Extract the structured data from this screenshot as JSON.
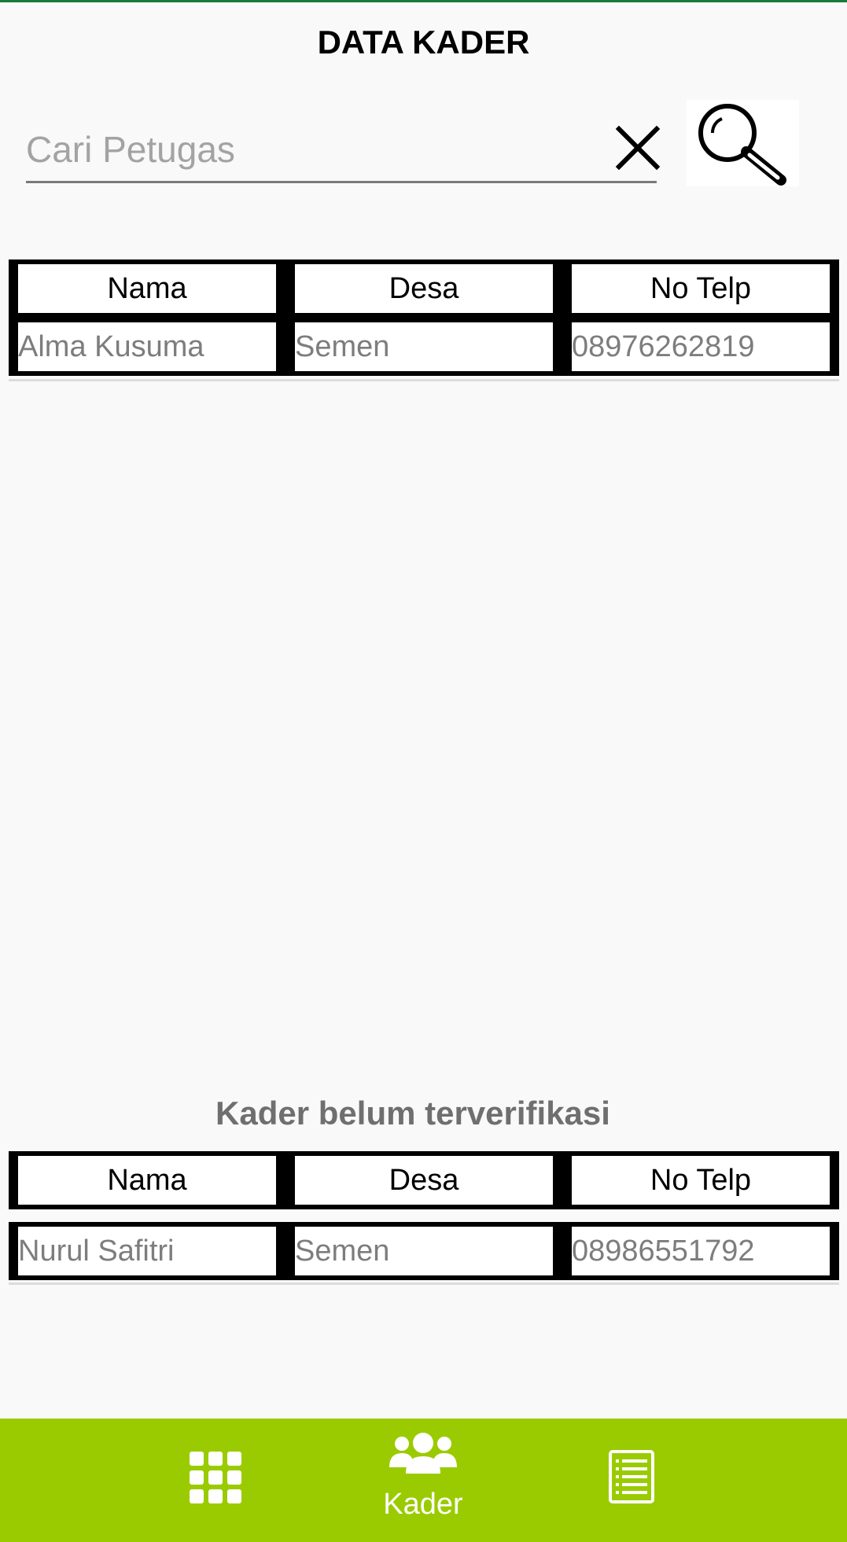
{
  "header": {
    "title": "DATA KADER"
  },
  "search": {
    "placeholder": "Cari Petugas",
    "value": ""
  },
  "verified_table": {
    "columns": [
      "Nama",
      "Desa",
      "No Telp"
    ],
    "rows": [
      [
        "Alma Kusuma",
        "Semen",
        "08976262819"
      ]
    ]
  },
  "unverified": {
    "title": "Kader belum terverifikasi",
    "columns": [
      "Nama",
      "Desa",
      "No Telp"
    ],
    "rows": [
      [
        "Nurul Safitri",
        "Semen",
        "08986551792"
      ]
    ]
  },
  "bottom_nav": {
    "items": [
      {
        "icon": "grid-icon",
        "label": ""
      },
      {
        "icon": "people-icon",
        "label": "Kader"
      },
      {
        "icon": "list-icon",
        "label": ""
      }
    ]
  },
  "colors": {
    "accent": "#9acb00",
    "top_line": "#1b7a3a"
  }
}
